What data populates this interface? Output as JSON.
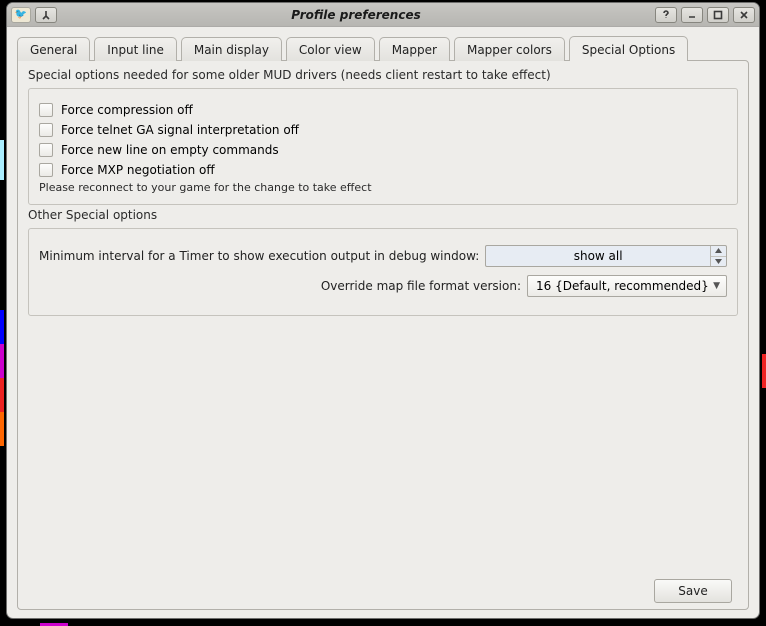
{
  "window": {
    "title": "Profile preferences"
  },
  "titlebar": {
    "icons": {
      "app": "app-icon",
      "pin": "pin-icon",
      "help": "help-icon",
      "min": "minimize-icon",
      "max": "maximize-icon",
      "close": "close-icon"
    }
  },
  "tabs": [
    {
      "id": "general",
      "label": "General"
    },
    {
      "id": "input-line",
      "label": "Input line"
    },
    {
      "id": "main-display",
      "label": "Main display"
    },
    {
      "id": "color-view",
      "label": "Color view"
    },
    {
      "id": "mapper",
      "label": "Mapper"
    },
    {
      "id": "mapper-colors",
      "label": "Mapper colors"
    },
    {
      "id": "special-options",
      "label": "Special Options",
      "active": true
    }
  ],
  "special": {
    "group1_title": "Special options needed for some older MUD drivers (needs client restart to take effect)",
    "checkboxes": [
      {
        "id": "force-compression-off",
        "label": "Force compression off"
      },
      {
        "id": "force-telnet-ga-off",
        "label": "Force telnet GA signal interpretation off"
      },
      {
        "id": "force-newline-empty",
        "label": "Force new line on empty commands"
      },
      {
        "id": "force-mxp-off",
        "label": "Force MXP negotiation off"
      }
    ],
    "reconnect_hint": "Please reconnect to your game for the change to take effect"
  },
  "other": {
    "title": "Other Special options",
    "timer_label": "Minimum interval for a Timer to show execution output in debug window:",
    "timer_value": "show all",
    "mapver_label": "Override map file format version:",
    "mapver_value": "16 {Default, recommended}"
  },
  "footer": {
    "save": "Save"
  }
}
